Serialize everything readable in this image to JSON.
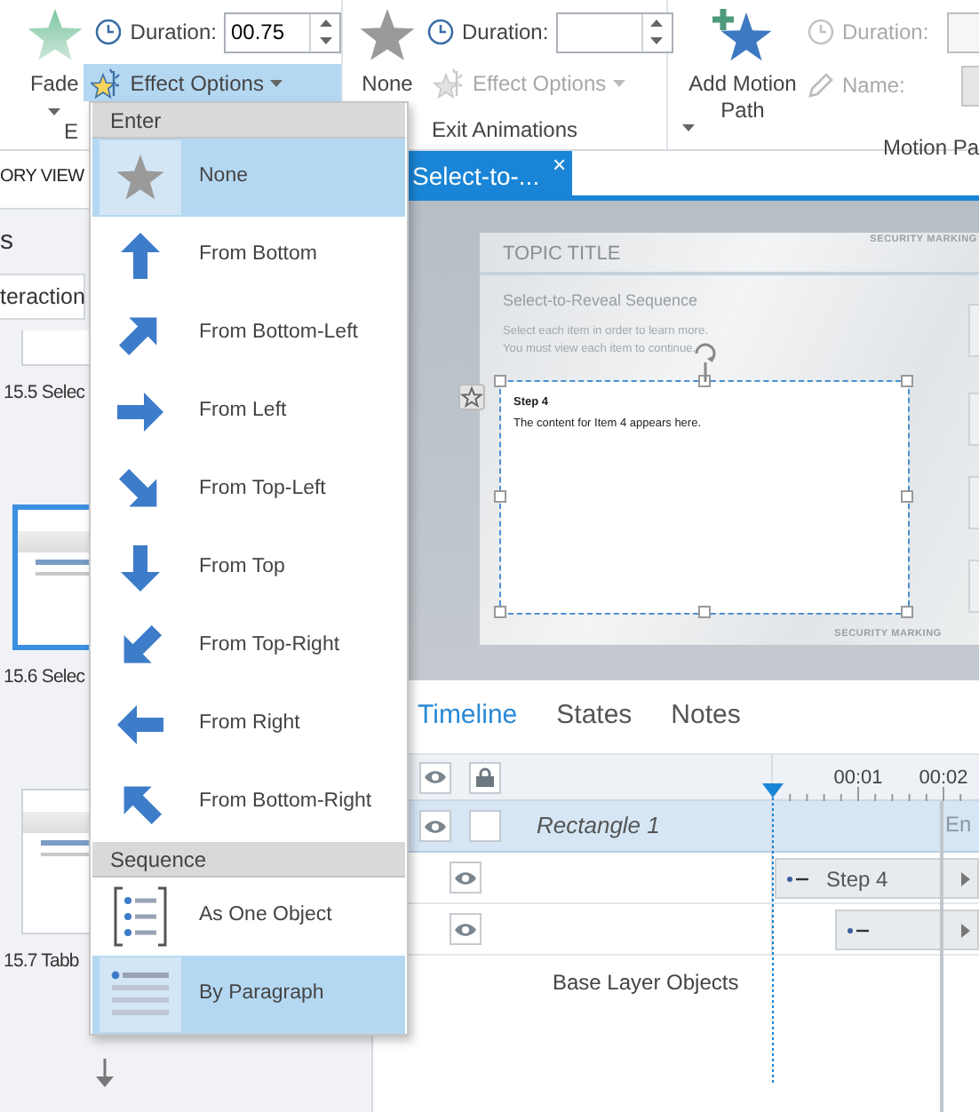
{
  "ribbon": {
    "entrance": {
      "effect": "Fade",
      "duration_label": "Duration:",
      "duration": "00.75",
      "effect_options": {
        "label": "Effect Options",
        "disabled": false,
        "expanded": true
      },
      "group_label": "E"
    },
    "exit": {
      "effect": "None",
      "duration_label": "Duration:",
      "effect_options": {
        "label": "Effect Options",
        "disabled": true,
        "expanded": false
      },
      "group_label": "Exit Animations"
    },
    "motion": {
      "button": "Add Motion Path",
      "duration_label": "Duration:",
      "name_label": "Name:",
      "disabled": true,
      "group_label": "Motion Pa"
    }
  },
  "story_panel": {
    "tab": "ORY VIEW",
    "heading": "s",
    "search": "teraction",
    "thumbnails": [
      {
        "label": "15.5 Selec",
        "selected": false
      },
      {
        "label": "15.6 Selec",
        "selected": true
      },
      {
        "label": "15.7 Tabb",
        "selected": false
      }
    ]
  },
  "document_tab": {
    "title": "Select-to-...",
    "close": "×"
  },
  "slide": {
    "title": "TOPIC TITLE",
    "marking_top": "SECURITY MARKING",
    "heading": "Select-to-Reveal Sequence",
    "instructions": [
      "Select each item in order to learn more.",
      "You must view each item to continue."
    ],
    "box": {
      "title": "Step 4",
      "text": "The content for Item 4 appears here.",
      "selected": true
    },
    "marking_bottom": "SECURITY MARKING"
  },
  "timeline": {
    "tabs": [
      {
        "label": "Timeline",
        "selected": true
      },
      {
        "label": "States",
        "selected": false
      },
      {
        "label": "Notes",
        "selected": false
      }
    ],
    "ticks": [
      "00:01",
      "00:02"
    ],
    "rows": [
      {
        "kind": "object",
        "name": "Rectangle 1",
        "selected": true,
        "end_label": "En"
      },
      {
        "kind": "state",
        "bar": "Step 4",
        "delayed": false
      },
      {
        "kind": "state",
        "delayed": true
      }
    ],
    "footer": "Base Layer Objects"
  },
  "effect_menu": {
    "sections": [
      {
        "title": "Enter",
        "items": [
          {
            "label": "None",
            "kind": "none",
            "selected": true
          },
          {
            "label": "From Bottom",
            "kind": "up",
            "selected": false
          },
          {
            "label": "From Bottom-Left",
            "kind": "upright",
            "selected": false
          },
          {
            "label": "From Left",
            "kind": "right",
            "selected": false
          },
          {
            "label": "From Top-Left",
            "kind": "downright",
            "selected": false
          },
          {
            "label": "From Top",
            "kind": "down",
            "selected": false
          },
          {
            "label": "From Top-Right",
            "kind": "downleft",
            "selected": false
          },
          {
            "label": "From Right",
            "kind": "left",
            "selected": false
          },
          {
            "label": "From Bottom-Right",
            "kind": "upleft",
            "selected": false
          }
        ]
      },
      {
        "title": "Sequence",
        "items": [
          {
            "label": "As One Object",
            "kind": "object",
            "selected": false
          },
          {
            "label": "By Paragraph",
            "kind": "paragraph",
            "selected": true
          }
        ]
      }
    ]
  }
}
